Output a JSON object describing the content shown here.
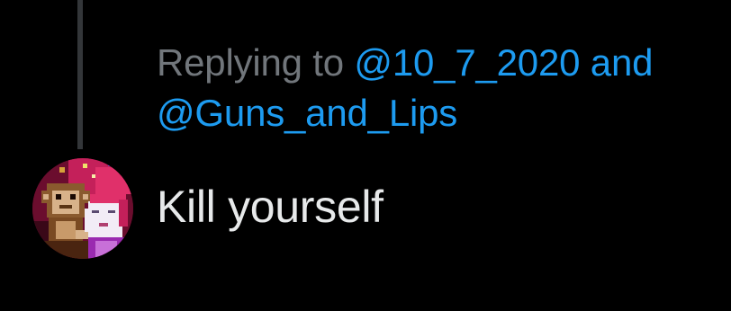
{
  "reply": {
    "prefix": "Replying to",
    "mention_1": "@10_7_2020",
    "conjunction": "and",
    "mention_2": "@Guns_and_Lips"
  },
  "tweet": {
    "text": "Kill yourself"
  },
  "avatar": {
    "icon": "avatar-monkey-pixel-art"
  },
  "colors": {
    "background": "#000000",
    "muted_text": "#71767b",
    "mention": "#1d9bf0",
    "body_text": "#e7e9ea",
    "thread_line": "#333639"
  }
}
